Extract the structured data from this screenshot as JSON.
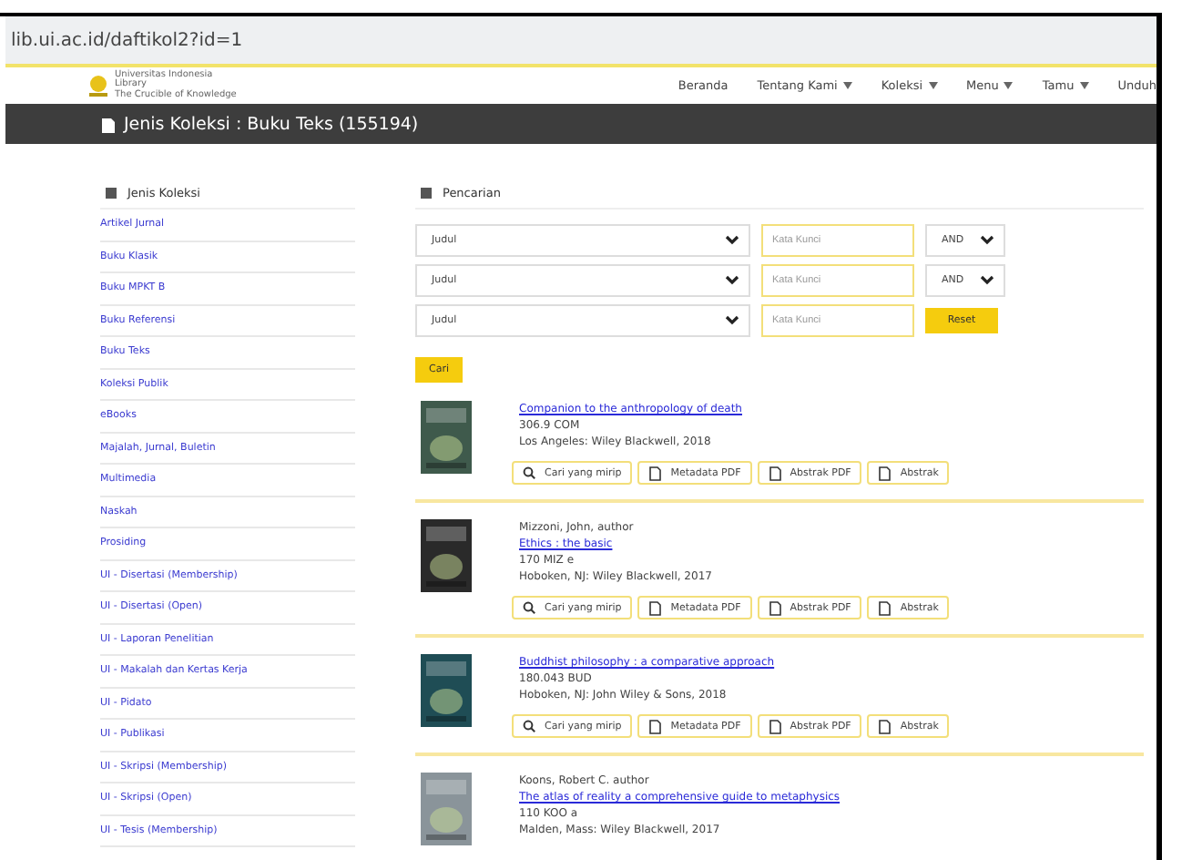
{
  "browser": {
    "url": "lib.ui.ac.id/daftikol2?id=1"
  },
  "navbar": {
    "logo_lines": [
      "Universitas Indonesia",
      "Library",
      "The Crucible of Knowledge"
    ],
    "items": [
      {
        "label": "Beranda",
        "dropdown": false
      },
      {
        "label": "Tentang Kami",
        "dropdown": true
      },
      {
        "label": "Koleksi",
        "dropdown": true
      },
      {
        "label": "Menu",
        "dropdown": true
      },
      {
        "label": "Tamu",
        "dropdown": true
      },
      {
        "label": "Unduh",
        "dropdown": false
      }
    ]
  },
  "page_header": {
    "title": "Jenis Koleksi : Buku Teks (155194)"
  },
  "sidebar": {
    "title": "Jenis Koleksi",
    "items": [
      "Artikel Jurnal",
      "Buku Klasik",
      "Buku MPKT B",
      "Buku Referensi",
      "Buku Teks",
      "Koleksi Publik",
      "eBooks",
      "Majalah, Jurnal, Buletin",
      "Multimedia",
      "Naskah",
      "Prosiding",
      "UI - Disertasi (Membership)",
      "UI - Disertasi (Open)",
      "UI - Laporan Penelitian",
      "UI - Makalah dan Kertas Kerja",
      "UI - Pidato",
      "UI - Publikasi",
      "UI - Skripsi (Membership)",
      "UI - Skripsi (Open)",
      "UI - Tesis (Membership)"
    ]
  },
  "search": {
    "title": "Pencarian",
    "rows": [
      {
        "field": "Judul",
        "placeholder": "Kata Kunci",
        "kind": "operator",
        "operator": "AND"
      },
      {
        "field": "Judul",
        "placeholder": "Kata Kunci",
        "kind": "operator",
        "operator": "AND"
      },
      {
        "field": "Judul",
        "placeholder": "Kata Kunci",
        "kind": "reset",
        "button": "Reset"
      }
    ],
    "submit": "Cari"
  },
  "results": [
    {
      "title": "Companion to the anthropology of death",
      "call_number": "306.9 COM",
      "publisher": "Los Angeles: Wiley Blackwell, 2018",
      "actions": [
        "Cari yang mirip",
        "Metadata PDF",
        "Abstrak PDF",
        "Abstrak"
      ]
    },
    {
      "author": "Mizzoni, John, author",
      "title": "Ethics : the basic",
      "call_number": "170 MIZ e",
      "publisher": "Hoboken, NJ: Wiley Blackwell, 2017",
      "actions": [
        "Cari yang mirip",
        "Metadata PDF",
        "Abstrak PDF",
        "Abstrak"
      ]
    },
    {
      "title": "Buddhist philosophy : a comparative approach",
      "call_number": "180.043 BUD",
      "publisher": "Hoboken, NJ: John Wiley & Sons, 2018",
      "actions": [
        "Cari yang mirip",
        "Metadata PDF",
        "Abstrak PDF",
        "Abstrak"
      ]
    },
    {
      "author": "Koons, Robert C. author",
      "title": "The atlas of reality a comprehensive guide to metaphysics",
      "call_number": "110 KOO a",
      "publisher": "Malden, Mass: Wiley Blackwell, 2017"
    }
  ]
}
